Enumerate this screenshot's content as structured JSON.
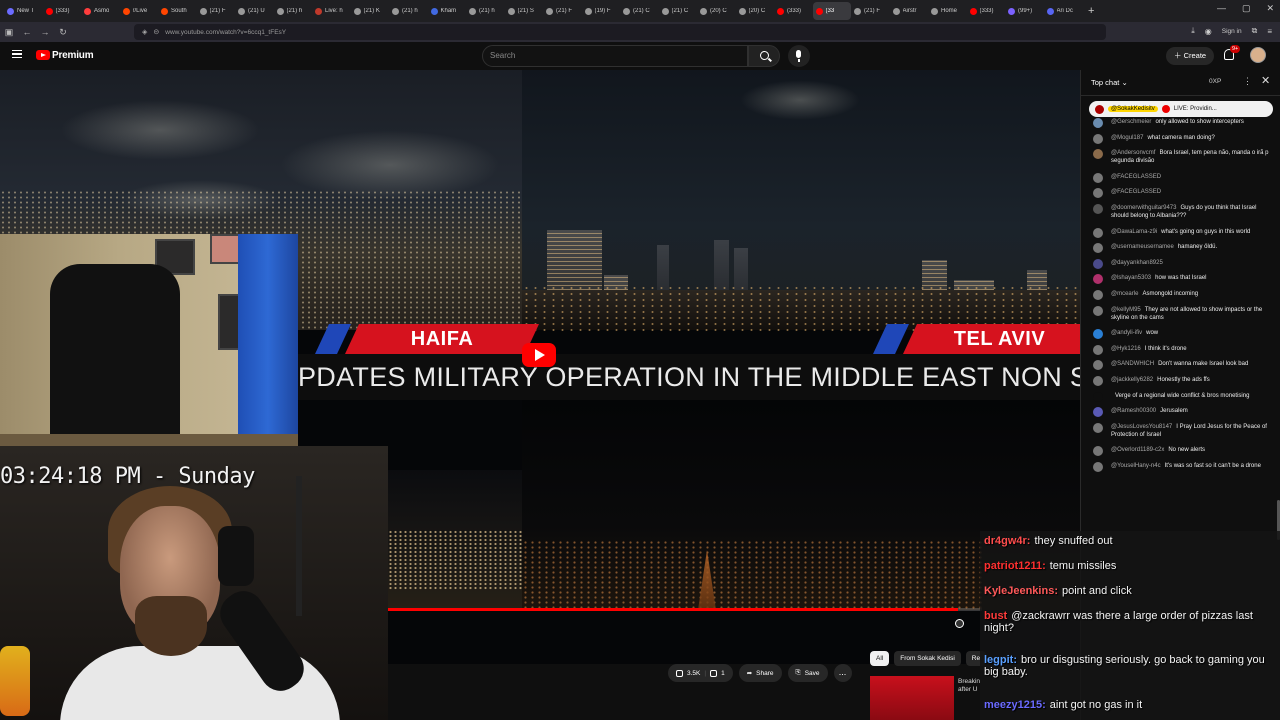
{
  "browser": {
    "tabs": [
      {
        "label": "New T",
        "color": "#6b6bff"
      },
      {
        "label": "(333)",
        "color": "#ff0000"
      },
      {
        "label": "Asmo",
        "color": "#ff3d3d"
      },
      {
        "label": "r/Live",
        "color": "#ff4500"
      },
      {
        "label": "South",
        "color": "#ff4500"
      },
      {
        "label": "(21) F",
        "color": "#999999"
      },
      {
        "label": "(21) U",
        "color": "#999999"
      },
      {
        "label": "(21) h",
        "color": "#999999"
      },
      {
        "label": "Live: h",
        "color": "#c0392b"
      },
      {
        "label": "(21) K",
        "color": "#999999"
      },
      {
        "label": "(21) h",
        "color": "#999999"
      },
      {
        "label": "Kham",
        "color": "#4169e1"
      },
      {
        "label": "(21) h",
        "color": "#999999"
      },
      {
        "label": "(21) S",
        "color": "#999999"
      },
      {
        "label": "(21) F",
        "color": "#999999"
      },
      {
        "label": "(19) F",
        "color": "#999999"
      },
      {
        "label": "(21) C",
        "color": "#999999"
      },
      {
        "label": "(21) C",
        "color": "#999999"
      },
      {
        "label": "(20) C",
        "color": "#999999"
      },
      {
        "label": "(20) C",
        "color": "#999999"
      },
      {
        "label": "(333)",
        "color": "#ff0000"
      },
      {
        "label": "(33",
        "color": "#ff0000",
        "active": true
      },
      {
        "label": "(21) F",
        "color": "#999999"
      },
      {
        "label": "Airstr",
        "color": "#999999"
      },
      {
        "label": "Home",
        "color": "#999999"
      },
      {
        "label": "(333)",
        "color": "#ff0000"
      },
      {
        "label": "(99+)",
        "color": "#7b61ff"
      },
      {
        "label": "Ari Dc",
        "color": "#5865f2"
      }
    ],
    "url": "www.youtube.com/watch?v=6ccq1_tFEsY",
    "sign_in": "Sign in"
  },
  "youtube": {
    "brand": "Premium",
    "search_placeholder": "Search",
    "create_label": "Create",
    "notifications": "9+"
  },
  "video": {
    "label_left": "HAIFA",
    "label_right": "TEL AVIV",
    "ticker": "PDATES MILITARY OPERATION IN THE MIDDLE EAST NON S",
    "progress_fraction": 0.96,
    "clock": "03:24:18 PM - Sunday"
  },
  "actions": {
    "likes": "3.5K",
    "dislikes": "1",
    "share": "Share",
    "save": "Save",
    "more": "..."
  },
  "filters": [
    "All",
    "From Sokak Kedisi",
    "Re"
  ],
  "recommendation": {
    "title_line1": "Breakin",
    "title_line2": "after U"
  },
  "chat": {
    "header": "Top chat",
    "points": "0XP",
    "pinned_user": "@SokakKedisitv",
    "pinned_text": "LIVE: Providin...",
    "messages": [
      {
        "user": "@Gerschmeier",
        "text": "only allowed to show intercepters",
        "color": "#6a8caf"
      },
      {
        "user": "@Mogul187",
        "text": "what camera man doing?",
        "color": "#777777"
      },
      {
        "user": "@Andersonvcmf",
        "text": "Bora Israel, tem pena não, manda o irã p segunda divisão",
        "color": "#8a6a4a"
      },
      {
        "user": "@FACEGLASSED",
        "text": "",
        "color": "#777777"
      },
      {
        "user": "@FACEGLASSED",
        "text": "",
        "color": "#777777"
      },
      {
        "user": "@doomerwithguitar9473",
        "text": "Guys do you think that Israel should belong to Albania???",
        "color": "#555555"
      },
      {
        "user": "@DawaLama-z9i",
        "text": "what's going on guys in this world",
        "color": "#777777"
      },
      {
        "user": "@usernameusernamee",
        "text": "hamaney öldü.",
        "color": "#777777"
      },
      {
        "user": "@dayyankhan8925",
        "text": "",
        "color": "#4a4a8a"
      },
      {
        "user": "@lshayan5303",
        "text": "how was that Israel",
        "color": "#b0306b"
      },
      {
        "user": "@mcearle",
        "text": "Asmongold incoming",
        "color": "#777777"
      },
      {
        "user": "@kellyM95",
        "text": "They are not allowed to show impacts or the skyline on the cams",
        "color": "#777777"
      },
      {
        "user": "@andyli-ifiv",
        "text": "wow",
        "color": "#2a7fd4"
      },
      {
        "user": "@Hyk1216",
        "text": "I think it's drone",
        "color": "#777777"
      },
      {
        "user": "@SANDWHICH",
        "text": "Don't wanna make Israel look bad",
        "color": "#777777"
      },
      {
        "user": "@jackkelly6282",
        "text": "Honestly the ads ffs",
        "color": "#777777"
      },
      {
        "user": "",
        "text": "Verge of a regional wide conflict & bros monetising",
        "color": "#0f0f0f"
      },
      {
        "user": "@Ramesh00300",
        "text": "Jerusalem",
        "color": "#5a5ab5"
      },
      {
        "user": "@JesusLovesYou8147",
        "text": "I Pray Lord Jesus for the Peace of Protection of Israel",
        "color": "#777777"
      },
      {
        "user": "@Overlord1189-c2x",
        "text": "No new alerts",
        "color": "#777777"
      },
      {
        "user": "@YouselHany-n4c",
        "text": "It's was so fast so it can't be a drone",
        "color": "#777777"
      }
    ]
  },
  "twitch_chat": [
    {
      "user": "dr4gw4r:",
      "text": "they snuffed out",
      "color": "#ff4d4d"
    },
    {
      "user": "patriot1211:",
      "text": "temu missiles",
      "color": "#ff3030"
    },
    {
      "user": "KyleJeenkins:",
      "text": "point and click",
      "color": "#ff5a5a"
    },
    {
      "user": "bust",
      "text": "@zackrawrr was there a large order of pizzas last night?",
      "color": "#ff3b3b"
    },
    {
      "user": "legpit:",
      "text": "bro ur disgusting seriously. go back to gaming you big baby.",
      "color": "#5aa0ff"
    },
    {
      "user": "meezy1215:",
      "text": "aint got no gas in it",
      "color": "#6a6aff"
    }
  ]
}
